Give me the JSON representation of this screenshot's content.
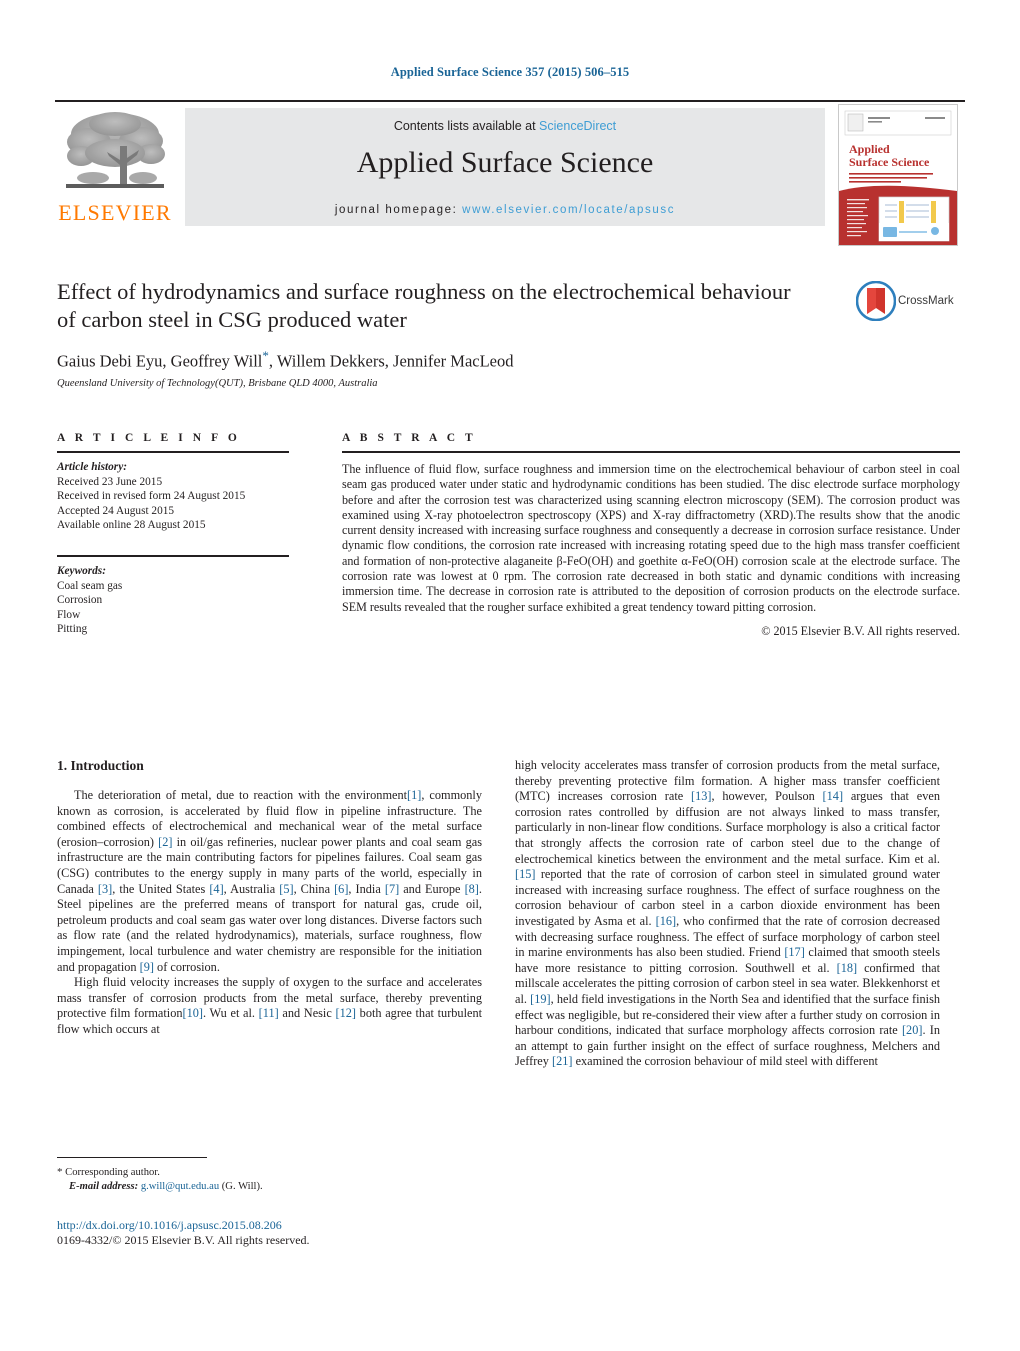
{
  "running_head": "Applied Surface Science 357 (2015) 506–515",
  "masthead": {
    "contents_prefix": "Contents lists available at ",
    "contents_link": "ScienceDirect",
    "journal_name": "Applied Surface Science",
    "homepage_prefix": "journal homepage: ",
    "homepage_url": "www.elsevier.com/locate/apsusc",
    "publisher_wordmark": "ELSEVIER",
    "cover": {
      "journal_title_line1": "Applied",
      "journal_title_line2": "Surface Science"
    }
  },
  "title_block": {
    "title": "Effect of hydrodynamics and surface roughness on the electrochemical behaviour of carbon steel in CSG produced water",
    "authors_pre": "Gaius Debi Eyu, Geoffrey Will",
    "corresponding_marker": "*",
    "authors_post": ", Willem Dekkers, Jennifer MacLeod",
    "affiliation": "Queensland University of Technology(QUT), Brisbane QLD 4000, Australia",
    "crossmark_label": "CrossMark"
  },
  "article_info": {
    "heading": "A R T I C L E    I N F O",
    "history_label": "Article history:",
    "history": [
      "Received 23 June 2015",
      "Received in revised form 24 August 2015",
      "Accepted 24 August 2015",
      "Available online 28 August 2015"
    ],
    "keywords_label": "Keywords:",
    "keywords": [
      "Coal seam gas",
      "Corrosion",
      "Flow",
      "Pitting"
    ]
  },
  "abstract": {
    "heading": "A B S T R A C T",
    "text": "The influence of fluid flow, surface roughness and immersion time on the electrochemical behaviour of carbon steel in coal seam gas produced water under static and hydrodynamic conditions has been studied. The disc electrode surface morphology before and after the corrosion test was characterized using scanning electron microscopy (SEM). The corrosion product was examined using X-ray photoelectron spectroscopy (XPS) and X-ray diffractometry (XRD).The results show that the anodic current density increased with increasing surface roughness and consequently a decrease in corrosion surface resistance. Under dynamic flow conditions, the corrosion rate increased with increasing rotating speed due to the high mass transfer coefficient and formation of non-protective alaganeite β-FeO(OH) and goethite α-FeO(OH) corrosion scale at the electrode surface. The corrosion rate was lowest at 0 rpm. The corrosion rate decreased in both static and dynamic conditions with increasing immersion time. The decrease in corrosion rate is attributed to the deposition of corrosion products on the electrode surface. SEM results revealed that the rougher surface exhibited a great tendency toward pitting corrosion.",
    "copyright": "© 2015 Elsevier B.V. All rights reserved."
  },
  "introduction": {
    "section_title": "1.  Introduction",
    "left_paragraphs": [
      {
        "parts": [
          {
            "t": "The deterioration of metal, due to reaction with the environment"
          },
          {
            "t": "[1]",
            "ref": true
          },
          {
            "t": ", commonly known as corrosion, is accelerated by fluid flow in pipeline infrastructure. The combined effects of electrochemical and mechanical wear of the metal surface (erosion–corrosion) "
          },
          {
            "t": "[2]",
            "ref": true
          },
          {
            "t": " in oil/gas refineries, nuclear power plants and coal seam gas infrastructure are the main contributing factors for pipelines failures. Coal seam gas (CSG) contributes to the energy supply in many parts of the world, especially in Canada "
          },
          {
            "t": "[3]",
            "ref": true
          },
          {
            "t": ", the United States "
          },
          {
            "t": "[4]",
            "ref": true
          },
          {
            "t": ", Australia "
          },
          {
            "t": "[5]",
            "ref": true
          },
          {
            "t": ", China "
          },
          {
            "t": "[6]",
            "ref": true
          },
          {
            "t": ", India "
          },
          {
            "t": "[7]",
            "ref": true
          },
          {
            "t": " and Europe "
          },
          {
            "t": "[8]",
            "ref": true
          },
          {
            "t": ". Steel pipelines are the preferred means of transport for natural gas, crude oil, petroleum products and coal seam gas water over long distances. Diverse factors such as flow rate (and the related hydrodynamics), materials, surface roughness, flow impingement, local turbulence and water chemistry are responsible for the initiation and propagation "
          },
          {
            "t": "[9]",
            "ref": true
          },
          {
            "t": " of corrosion."
          }
        ]
      },
      {
        "parts": [
          {
            "t": "High fluid velocity increases the supply of oxygen to the surface and accelerates mass transfer of corrosion products from the metal surface, thereby preventing protective film formation"
          },
          {
            "t": "[10]",
            "ref": true
          },
          {
            "t": ". Wu et al. "
          },
          {
            "t": "[11]",
            "ref": true
          },
          {
            "t": " and Nesic "
          },
          {
            "t": "[12]",
            "ref": true
          },
          {
            "t": " both agree that turbulent flow which occurs at"
          }
        ]
      }
    ],
    "right_paragraphs": [
      {
        "parts": [
          {
            "t": "high velocity accelerates mass transfer of corrosion products from the metal surface, thereby preventing protective film formation. A higher mass transfer coefficient (MTC) increases corrosion rate "
          },
          {
            "t": "[13]",
            "ref": true
          },
          {
            "t": ", however, Poulson "
          },
          {
            "t": "[14]",
            "ref": true
          },
          {
            "t": " argues that even corrosion rates controlled by diffusion are not always linked to mass transfer, particularly in non-linear flow conditions. Surface morphology is also a critical factor that strongly affects the corrosion rate of carbon steel due to the change of electrochemical kinetics between the environment and the metal surface. Kim et al. "
          },
          {
            "t": "[15]",
            "ref": true
          },
          {
            "t": " reported that the rate of corrosion of carbon steel in simulated ground water increased with increasing surface roughness. The effect of surface roughness on the corrosion behaviour of carbon steel in a carbon dioxide environment has been investigated by Asma et al. "
          },
          {
            "t": "[16]",
            "ref": true
          },
          {
            "t": ", who confirmed that the rate of corrosion decreased with decreasing surface roughness. The effect of surface morphology of carbon steel in marine environments has also been studied. Friend "
          },
          {
            "t": "[17]",
            "ref": true
          },
          {
            "t": " claimed that smooth steels have more resistance to pitting corrosion. Southwell et al. "
          },
          {
            "t": "[18]",
            "ref": true
          },
          {
            "t": " confirmed that millscale accelerates the pitting corrosion of carbon steel in sea water. Blekkenhorst et al. "
          },
          {
            "t": "[19]",
            "ref": true
          },
          {
            "t": ", held field investigations in the North Sea and identified that the surface finish effect was negligible, but re-considered their view after a further study on corrosion in harbour conditions, indicated that surface morphology affects corrosion rate "
          },
          {
            "t": "[20]",
            "ref": true
          },
          {
            "t": ". In an attempt to gain further insight on the effect of surface roughness, Melchers and Jeffrey "
          },
          {
            "t": "[21]",
            "ref": true
          },
          {
            "t": " examined the corrosion behaviour of mild steel with different"
          }
        ]
      }
    ]
  },
  "footer": {
    "corresponding_marker": "*",
    "corresponding_label": "Corresponding author.",
    "email_label": "E-mail address:",
    "email": "g.will@qut.edu.au",
    "email_suffix": "(G. Will).",
    "doi_url": "http://dx.doi.org/10.1016/j.apsusc.2015.08.206",
    "issn_line": "0169-4332/© 2015 Elsevier B.V. All rights reserved."
  }
}
